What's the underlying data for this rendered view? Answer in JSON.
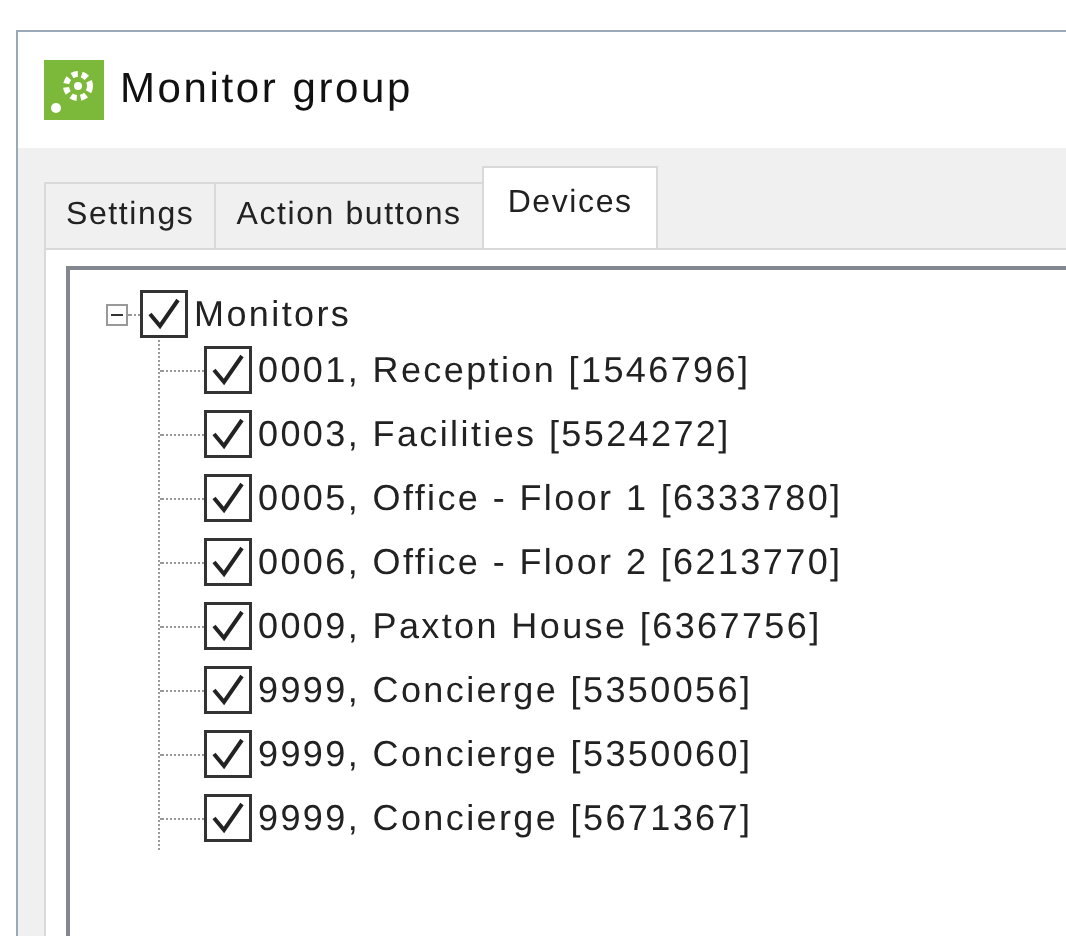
{
  "window": {
    "title": "Monitor group"
  },
  "tabs": [
    {
      "label": "Settings",
      "selected": false
    },
    {
      "label": "Action buttons",
      "selected": false
    },
    {
      "label": "Devices",
      "selected": true
    }
  ],
  "tree": [
    {
      "label": "Monitors",
      "checked": true,
      "expanded": true,
      "children": [
        {
          "label": "0001, Reception [1546796]",
          "checked": true
        },
        {
          "label": "0003, Facilities [5524272]",
          "checked": true
        },
        {
          "label": "0005, Office - Floor 1 [6333780]",
          "checked": true
        },
        {
          "label": "0006, Office - Floor 2 [6213770]",
          "checked": true
        },
        {
          "label": "0009, Paxton House [6367756]",
          "checked": true
        },
        {
          "label": "9999, Concierge [5350056]",
          "checked": true
        },
        {
          "label": "9999, Concierge [5350060]",
          "checked": true
        },
        {
          "label": "9999, Concierge [5671367]",
          "checked": true
        }
      ]
    }
  ]
}
